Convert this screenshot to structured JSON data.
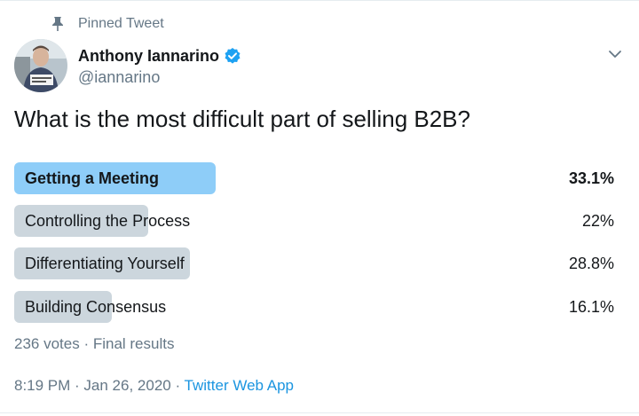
{
  "pinned_label": "Pinned Tweet",
  "author": {
    "name": "Anthony Iannarino",
    "handle": "@iannarino",
    "verified": true
  },
  "tweet_text": "What is the most difficult part of selling B2B?",
  "poll": {
    "options": [
      {
        "label": "Getting a Meeting",
        "percent_text": "33.1%",
        "percent": 33.1,
        "winner": true
      },
      {
        "label": "Controlling the Process",
        "percent_text": "22%",
        "percent": 22,
        "winner": false
      },
      {
        "label": "Differentiating Yourself",
        "percent_text": "28.8%",
        "percent": 28.8,
        "winner": false
      },
      {
        "label": "Building Consensus",
        "percent_text": "16.1%",
        "percent": 16.1,
        "winner": false
      }
    ],
    "summary": "236 votes · Final results"
  },
  "meta": {
    "time": "8:19 PM",
    "separator_1": " · ",
    "date": "Jan 26, 2020",
    "separator_2": " · ",
    "source": "Twitter Web App"
  },
  "colors": {
    "winner_bar": "#8ecdf8",
    "bar": "#ccd6dd",
    "link": "#1b95e0",
    "secondary_text": "#657786",
    "verified": "#1da1f2"
  }
}
